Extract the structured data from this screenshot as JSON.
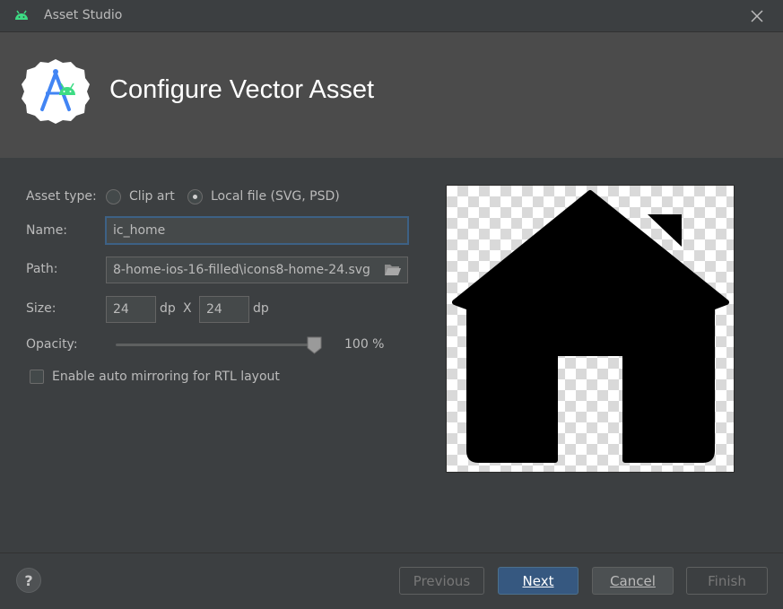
{
  "window": {
    "title": "Asset Studio"
  },
  "header": {
    "heading": "Configure Vector Asset"
  },
  "form": {
    "asset_type_label": "Asset type:",
    "asset_type_options": [
      {
        "label": "Clip art",
        "selected": false
      },
      {
        "label": "Local file (SVG, PSD)",
        "selected": true
      }
    ],
    "name_label": "Name:",
    "name_value": "ic_home",
    "path_label": "Path:",
    "path_value": "8-home-ios-16-filled\\icons8-home-24.svg",
    "size_label": "Size:",
    "width_value": "24",
    "height_value": "24",
    "unit": "dp",
    "size_separator": "X",
    "opacity_label": "Opacity:",
    "opacity_value": "100 %",
    "opacity_fraction": 1.0,
    "rtl_label": "Enable auto mirroring for RTL layout",
    "rtl_checked": false
  },
  "footer": {
    "help": "?",
    "previous": "Previous",
    "next": "Next",
    "cancel": "Cancel",
    "finish": "Finish"
  },
  "icons": {
    "app": "android-icon",
    "close": "close-icon",
    "logo": "android-studio-logo",
    "folder": "folder-icon",
    "preview": "home-icon"
  },
  "colors": {
    "background": "#3c3f41",
    "header": "#4b4b4b",
    "primary_button": "#365880",
    "focus_border": "#3d6185"
  }
}
